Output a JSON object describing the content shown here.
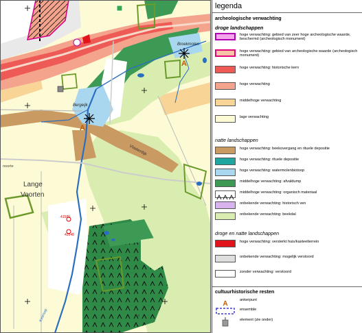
{
  "map": {
    "place_labels": {
      "broekmolen": "Broekmolen",
      "bergeijk": "Bergeijk",
      "vlasterdijk": "Vlasterdijk",
      "lange_voorten_1": "Lange",
      "lange_voorten_2": "Voorten",
      "north": "noorte",
      "marker_1": "41580",
      "marker_2": "42548",
      "stream": "Keersop",
      "school": "D-2"
    },
    "anchor_symbol": "A"
  },
  "legend": {
    "title": "legenda",
    "section_archeo": "archeologische verwachting",
    "group_dry": "droge landschappen",
    "items_dry": [
      {
        "label": "hoge verwachting: gebied van zeer hoge archeologische waarde, beschermd (archeologisch monument)",
        "color": "#f4a6ec",
        "border": "#b400b4"
      },
      {
        "label": "hoge verwachting: gebied van archeologische waarde (archeologisch monument)",
        "color": "#f7c3a8",
        "border": "#e0007a"
      },
      {
        "label": "hoge verwachting: historische kern",
        "color": "#ee5a55",
        "border": "#555"
      },
      {
        "label": "hoge verwachting",
        "color": "#f4a38c",
        "border": "#555"
      },
      {
        "label": "middelhoge verwachting",
        "color": "#f8d497",
        "border": "#555"
      },
      {
        "label": "lage verwachting",
        "color": "#fdfbd6",
        "border": "#555"
      }
    ],
    "group_wet": "natte landschappen",
    "items_wet": [
      {
        "label": "hoge verwachting: beekovergang en rituele depositie",
        "color": "#c99a62",
        "border": "#555"
      },
      {
        "label": "hoge verwachting: rituele depositie",
        "color": "#1fa6a0",
        "border": "#555"
      },
      {
        "label": "hoge verwachting: watermolenbiotoop",
        "color": "#a9d7ef",
        "border": "#555"
      },
      {
        "label": "middelhoge verwachting: afvaldump",
        "color": "#3d9a55",
        "border": "#555"
      },
      {
        "label": "middelhoge verwachting: organisch materiaal",
        "color": "#ffffff",
        "border": "#555",
        "pattern": "arrows"
      },
      {
        "label": "onbekende verwachting: historisch ven",
        "color": "#d6b3ec",
        "border": "#555"
      },
      {
        "label": "onbekende verwachting: beekdal",
        "color": "#d9edb0",
        "border": "#555"
      }
    ],
    "group_both": "droge en natte landschappen",
    "items_both": [
      {
        "label": "hoge verwachting: versterkt huis/kasteelterrein",
        "color": "#e0141a",
        "border": "#555"
      },
      {
        "label": "onbekende verwachting: mogelijk verstoord",
        "color": "#dedede",
        "border": "#555"
      },
      {
        "label": "zonder verwachting: verstoord",
        "color": "#ffffff",
        "border": "#555"
      }
    ],
    "section_cultural": "cultuurhistorische resten",
    "items_cultural": [
      {
        "label": "ankerpunt",
        "symbol": "A",
        "icon": "anchor-point-icon"
      },
      {
        "label": "ensemble",
        "icon": "ensemble-dashed-icon"
      },
      {
        "label": "element (zie onder)",
        "icon": "element-icon"
      }
    ]
  }
}
